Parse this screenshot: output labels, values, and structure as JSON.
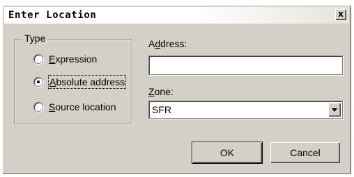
{
  "window": {
    "title": "Enter Location",
    "close_glyph": "x",
    "close_icon": "close-icon"
  },
  "type_group": {
    "label": "Type",
    "options": [
      {
        "label": "Expression",
        "mnemonic": "E",
        "rest": "xpression",
        "checked": false
      },
      {
        "label": "Absolute address",
        "mnemonic": "A",
        "rest": "bsolute address",
        "checked": true
      },
      {
        "label": "Source location",
        "mnemonic": "S",
        "rest": "ource location",
        "checked": false
      }
    ]
  },
  "address": {
    "label_pre": "A",
    "label_mnemonic": "d",
    "label_post": "dress:",
    "value": ""
  },
  "zone": {
    "label_mnemonic": "Z",
    "label_post": "one:",
    "selected": "SFR",
    "dropdown_icon": "chevron-down-icon"
  },
  "buttons": {
    "ok": "OK",
    "cancel": "Cancel"
  }
}
